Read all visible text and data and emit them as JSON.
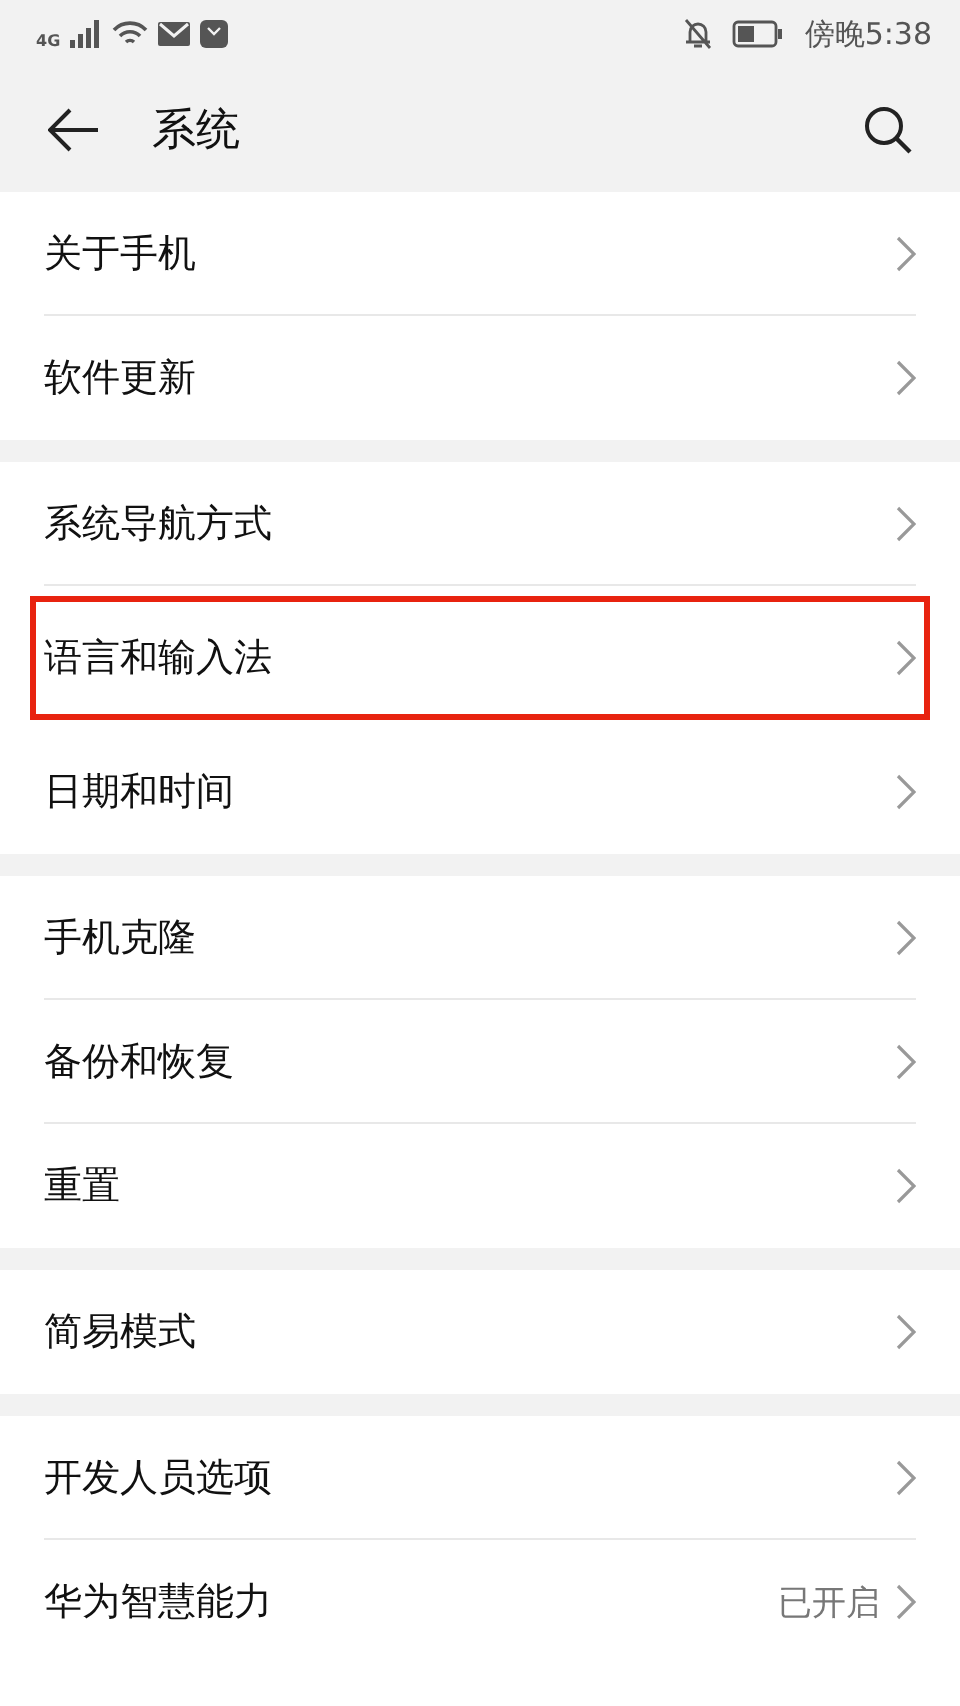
{
  "status_bar": {
    "network": "4G",
    "time": "傍晚5:38"
  },
  "header": {
    "title": "系统"
  },
  "groups": [
    {
      "items": [
        {
          "label": "关于手机",
          "highlighted": false
        },
        {
          "label": "软件更新",
          "highlighted": false
        }
      ]
    },
    {
      "items": [
        {
          "label": "系统导航方式",
          "highlighted": false
        },
        {
          "label": "语言和输入法",
          "highlighted": true
        },
        {
          "label": "日期和时间",
          "highlighted": false
        }
      ]
    },
    {
      "items": [
        {
          "label": "手机克隆",
          "highlighted": false
        },
        {
          "label": "备份和恢复",
          "highlighted": false
        },
        {
          "label": "重置",
          "highlighted": false
        }
      ]
    },
    {
      "items": [
        {
          "label": "简易模式",
          "highlighted": false
        }
      ]
    },
    {
      "items": [
        {
          "label": "开发人员选项",
          "highlighted": false
        },
        {
          "label": "华为智慧能力",
          "value": "已开启",
          "highlighted": false
        }
      ]
    }
  ]
}
